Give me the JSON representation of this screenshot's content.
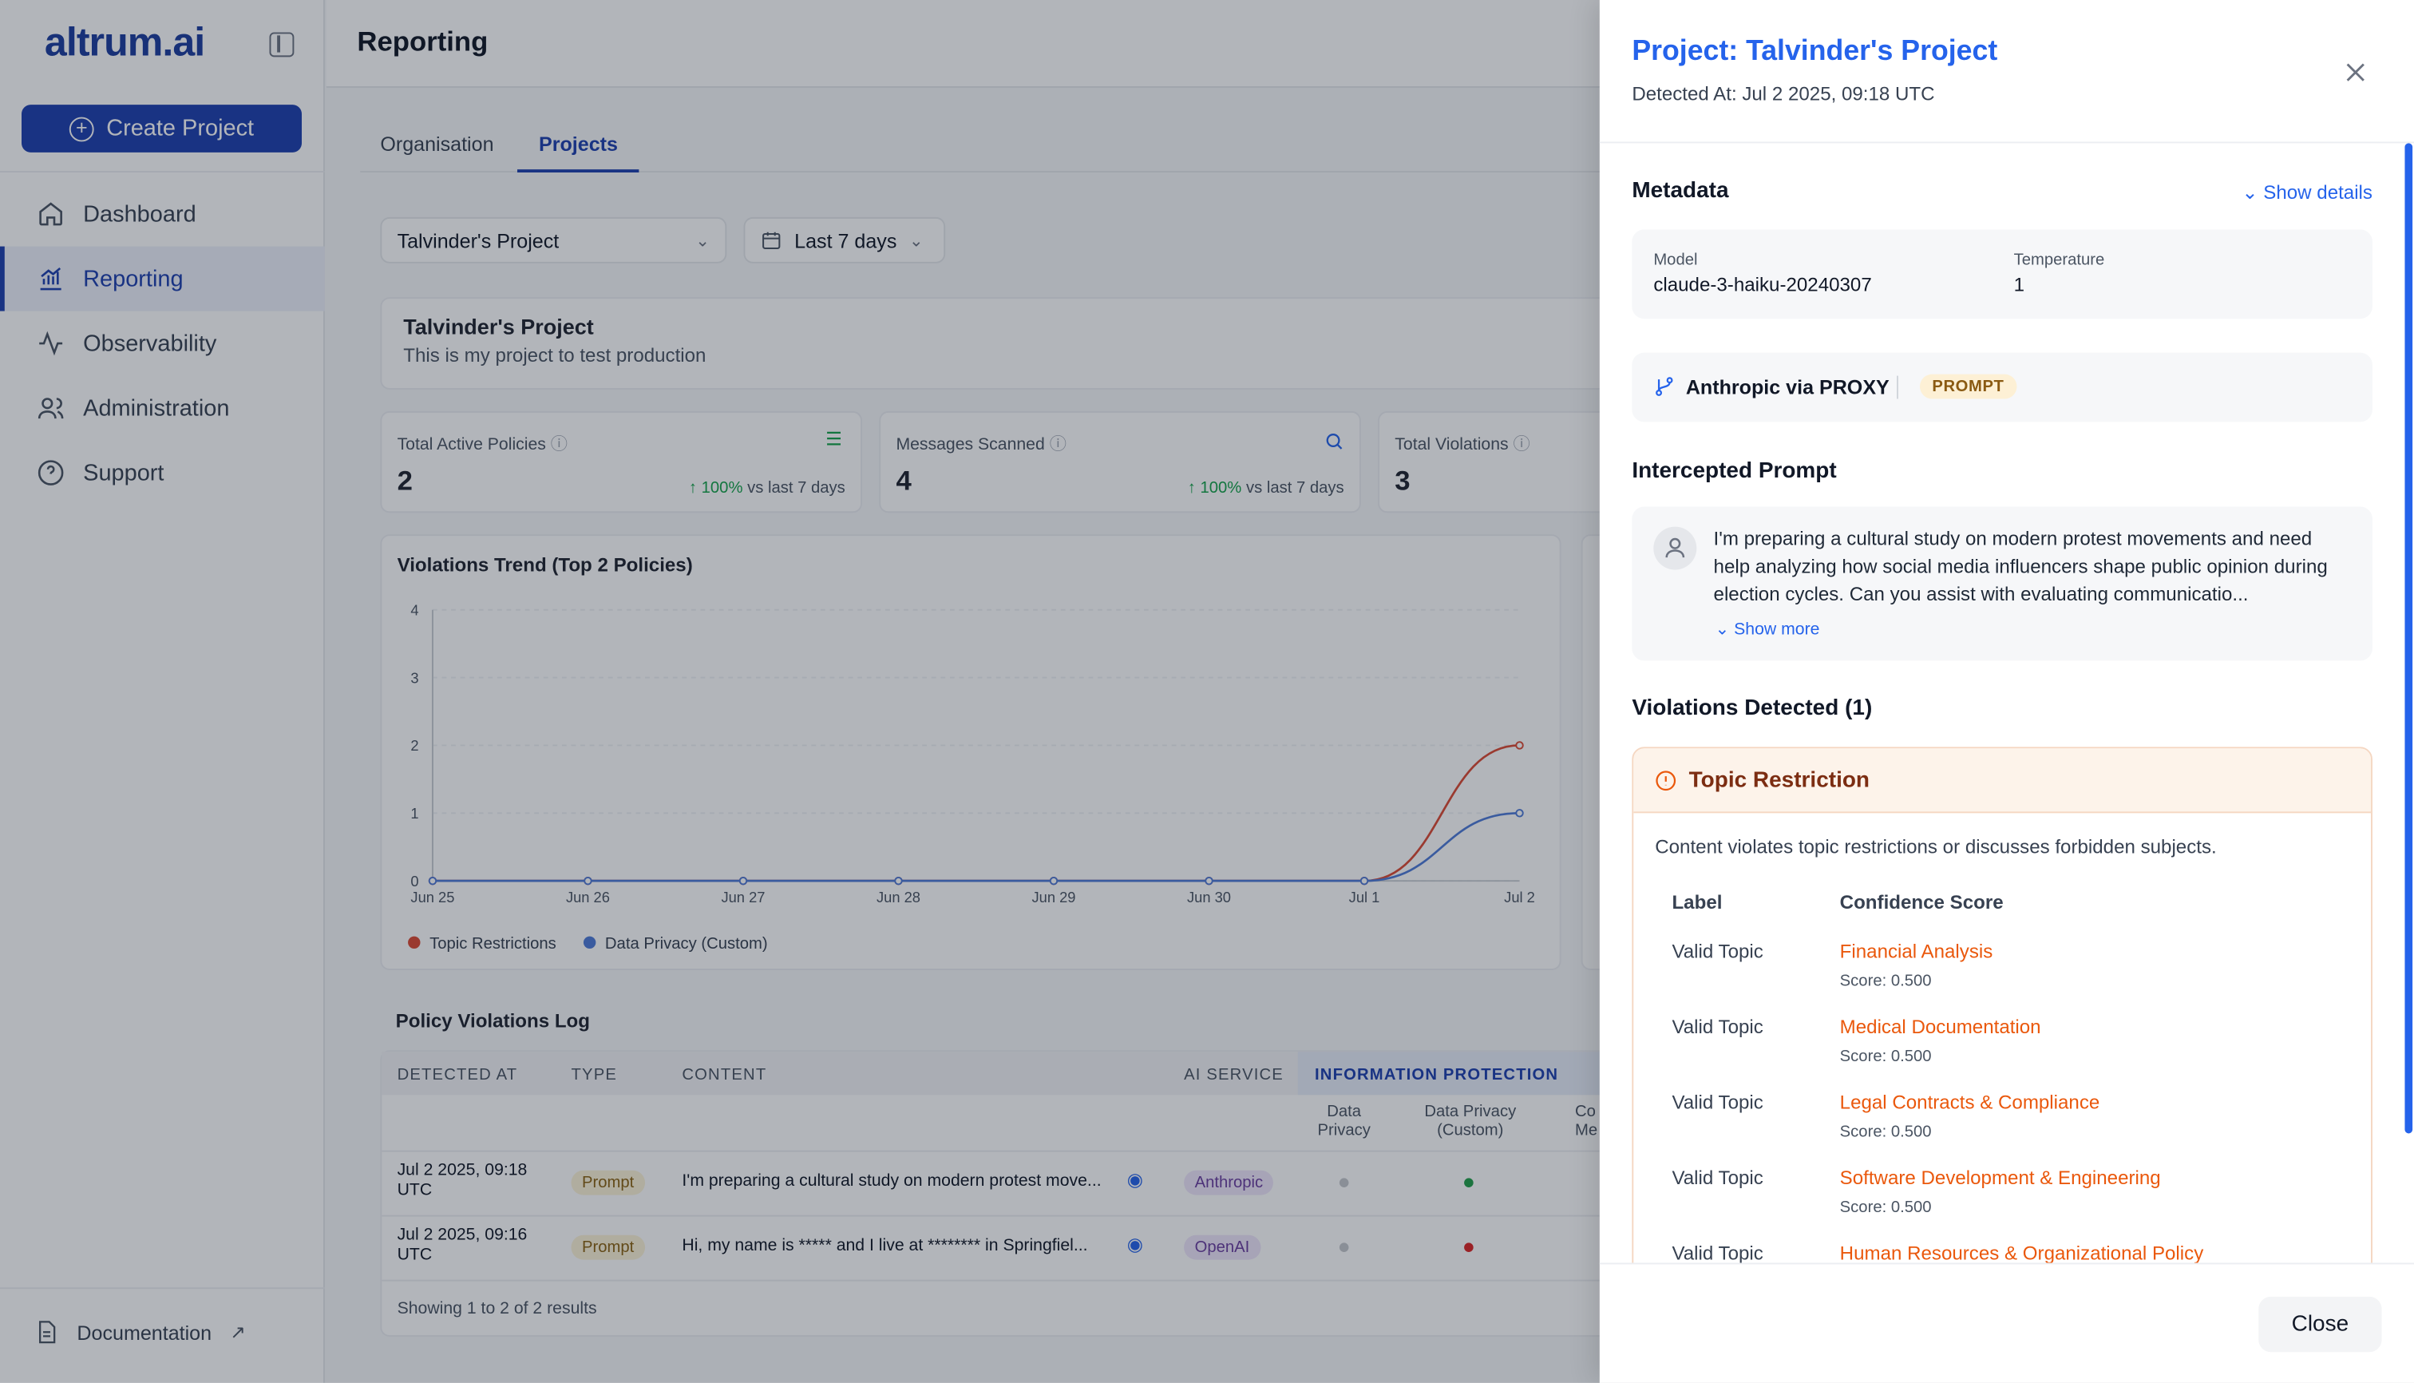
{
  "app": {
    "logo": "altrum.ai",
    "create_button": "Create Project",
    "nav": [
      {
        "label": "Dashboard",
        "icon": "home-icon"
      },
      {
        "label": "Reporting",
        "icon": "chart-icon"
      },
      {
        "label": "Observability",
        "icon": "activity-icon"
      },
      {
        "label": "Administration",
        "icon": "users-icon"
      },
      {
        "label": "Support",
        "icon": "help-icon"
      }
    ],
    "documentation": "Documentation"
  },
  "page": {
    "title": "Reporting",
    "tabs": [
      "Organisation",
      "Projects"
    ],
    "active_tab": "Projects",
    "project_select": "Talvinder's Project",
    "range_select": "Last 7 days",
    "project": {
      "name": "Talvinder's Project",
      "description": "This is my project to test production"
    },
    "stats": [
      {
        "label": "Total Active Policies",
        "value": "2",
        "trend": "100%",
        "trend_suffix": "vs last 7 days"
      },
      {
        "label": "Messages Scanned",
        "value": "4",
        "trend": "100%",
        "trend_suffix": "vs last 7 days"
      },
      {
        "label": "Total Violations",
        "value": "3"
      }
    ]
  },
  "chart_data": {
    "type": "line",
    "title": "Violations Trend (Top 2 Policies)",
    "categories": [
      "Jun 25",
      "Jun 26",
      "Jun 27",
      "Jun 28",
      "Jun 29",
      "Jun 30",
      "Jul 1",
      "Jul 2"
    ],
    "y_ticks": [
      "0",
      "1",
      "2",
      "3",
      "4"
    ],
    "ylim": [
      0,
      4
    ],
    "series": [
      {
        "name": "Topic Restrictions",
        "color": "#dc4b34",
        "values": [
          0,
          0,
          0,
          0,
          0,
          0,
          0,
          2
        ]
      },
      {
        "name": "Data Privacy (Custom)",
        "color": "#4f7bd8",
        "values": [
          0,
          0,
          0,
          0,
          0,
          0,
          0,
          1
        ]
      }
    ],
    "grid": true,
    "legend": "bottom-left"
  },
  "log": {
    "title": "Policy Violations Log",
    "headers": [
      "DETECTED AT",
      "TYPE",
      "CONTENT",
      "AI SERVICE",
      "INFORMATION PROTECTION"
    ],
    "subheaders": [
      "Data Privacy",
      "Data Privacy (Custom)",
      "Co Me"
    ],
    "rows": [
      {
        "detected": "Jul 2 2025, 09:18 UTC",
        "type": "Prompt",
        "content": "I'm preparing a cultural study on modern protest move...",
        "service": "Anthropic"
      },
      {
        "detected": "Jul 2 2025, 09:16 UTC",
        "type": "Prompt",
        "content": "Hi, my name is ***** and I live at ******** in Springfiel...",
        "service": "OpenAI"
      }
    ],
    "footer": "Showing 1 to 2 of 2 results"
  },
  "drawer": {
    "title": "Project: Talvinder's Project",
    "detected": "Detected At: Jul 2 2025, 09:18 UTC",
    "metadata_title": "Metadata",
    "show_details": "Show details",
    "model_label": "Model",
    "model_value": "claude-3-haiku-20240307",
    "temp_label": "Temperature",
    "temp_value": "1",
    "service": "Anthropic via PROXY",
    "service_badge": "PROMPT",
    "prompt_title": "Intercepted Prompt",
    "prompt_text": "I'm preparing a cultural study on modern protest movements and need help analyzing how social media influencers shape public opinion during election cycles. Can you assist with evaluating communicatio...",
    "show_more": "Show more",
    "violations_title": "Violations Detected (1)",
    "violation": {
      "name": "Topic Restriction",
      "description": "Content violates topic restrictions or discusses forbidden subjects.",
      "col_label": "Label",
      "col_score": "Confidence Score",
      "rows": [
        {
          "label": "Valid Topic",
          "topic": "Financial Analysis",
          "score": "Score: 0.500"
        },
        {
          "label": "Valid Topic",
          "topic": "Medical Documentation",
          "score": "Score: 0.500"
        },
        {
          "label": "Valid Topic",
          "topic": "Legal Contracts & Compliance",
          "score": "Score: 0.500"
        },
        {
          "label": "Valid Topic",
          "topic": "Software Development & Engineering",
          "score": "Score: 0.500"
        },
        {
          "label": "Valid Topic",
          "topic": "Human Resources & Organizational Policy",
          "score": ""
        }
      ]
    },
    "close_button": "Close"
  }
}
